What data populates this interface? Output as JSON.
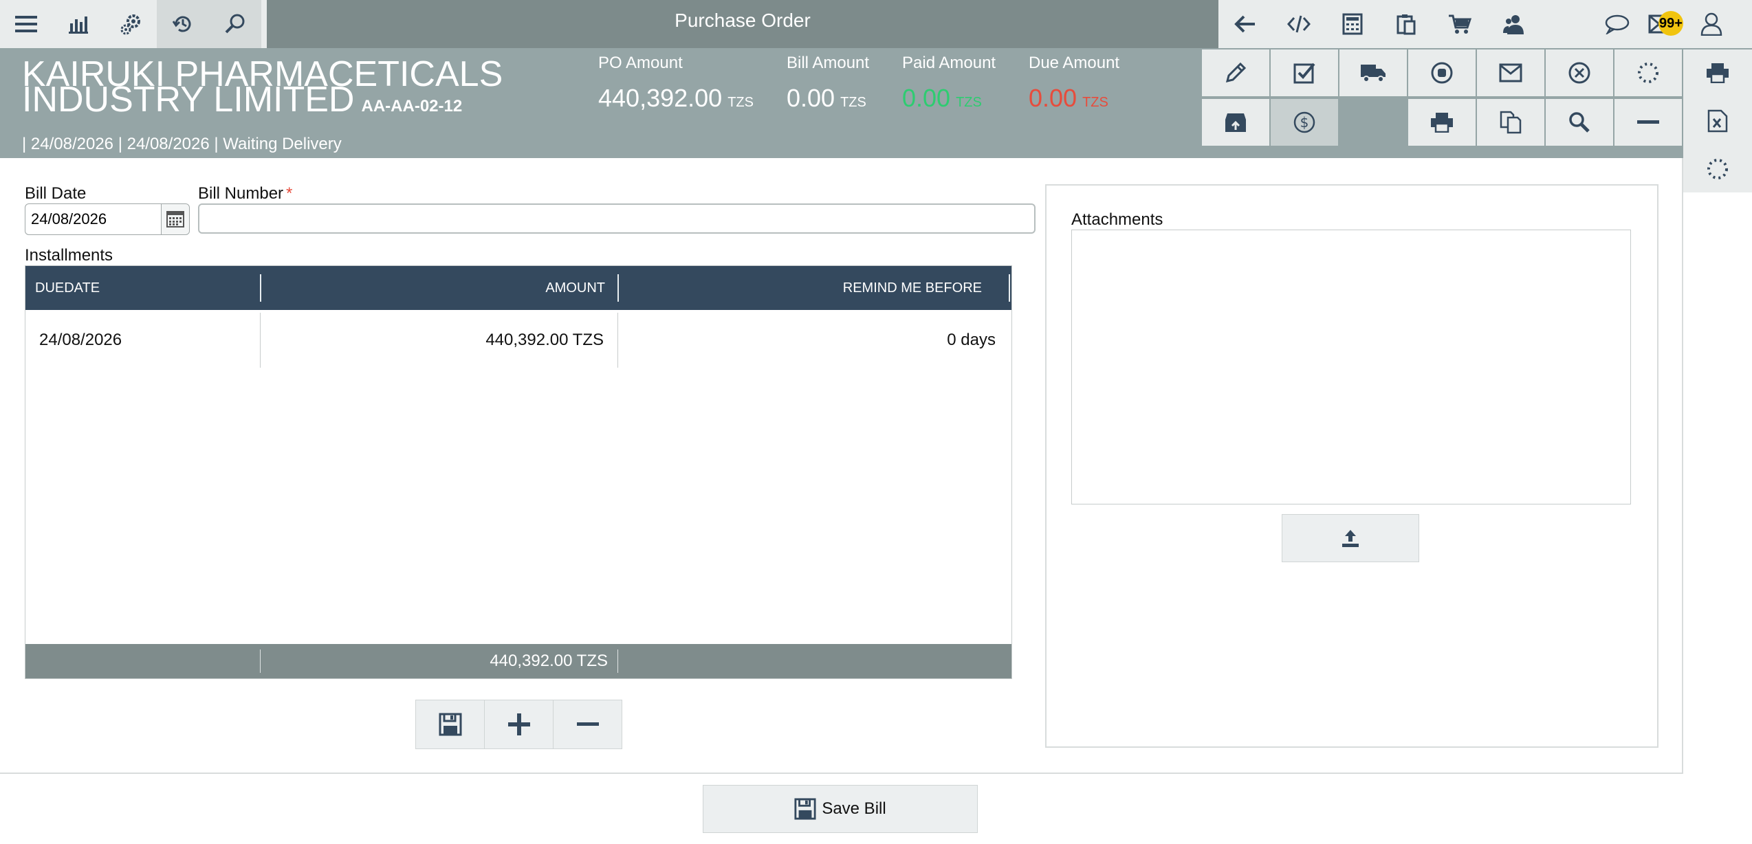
{
  "topbar": {
    "title": "Purchase Order",
    "notification_count": "99+"
  },
  "header": {
    "company_line1": "KAIRUKI PHARMACETICALS",
    "company_line2": "INDUSTRY LIMITED",
    "po_code": "AA-AA-02-12",
    "subline": "| 24/08/2026 | 24/08/2026 | Waiting Delivery",
    "amounts": {
      "po": {
        "label": "PO Amount",
        "value": "440,392.00",
        "currency": "TZS"
      },
      "bill": {
        "label": "Bill Amount",
        "value": "0.00",
        "currency": "TZS"
      },
      "paid": {
        "label": "Paid Amount",
        "value": "0.00",
        "currency": "TZS",
        "color": "#2ecc71"
      },
      "due": {
        "label": "Due Amount",
        "value": "0.00",
        "currency": "TZS",
        "color": "#e74c3c"
      }
    }
  },
  "form": {
    "bill_date_label": "Bill Date",
    "bill_date_value": "24/08/2026",
    "bill_number_label": "Bill Number",
    "bill_number_required": "*",
    "bill_number_value": "",
    "installments_label": "Installments"
  },
  "grid": {
    "columns": [
      "DUEDATE",
      "AMOUNT",
      "REMIND ME BEFORE"
    ],
    "rows": [
      {
        "duedate": "24/08/2026",
        "amount": "440,392.00 TZS",
        "remind": "0 days"
      }
    ],
    "footer_total": "440,392.00 TZS"
  },
  "attachments": {
    "label": "Attachments"
  },
  "save_bill_label": "Save Bill",
  "colors": {
    "topbar": "#7d8b8b",
    "header": "#95a5a6",
    "grid_header": "#34495e",
    "grid_footer": "#7f8c8c",
    "badge": "#f1c40f"
  }
}
